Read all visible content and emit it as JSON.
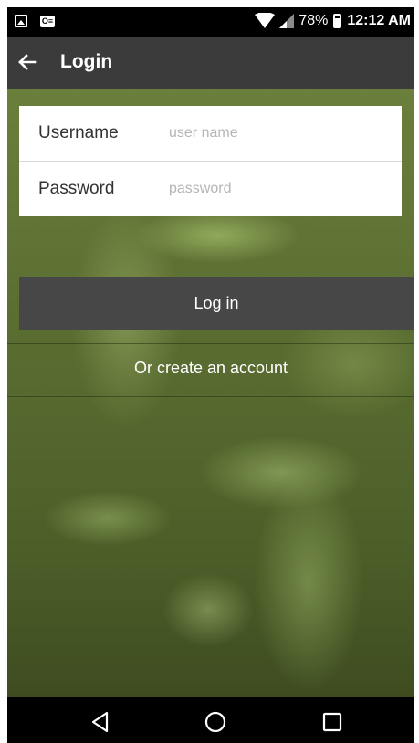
{
  "status_bar": {
    "left_icons": [
      "image-icon",
      "outlook-icon"
    ],
    "outlook_glyph": "O≡",
    "battery": "78%",
    "time": "12:12 AM"
  },
  "app_bar": {
    "title": "Login",
    "back_icon": "arrow-left-icon"
  },
  "form": {
    "username_label": "Username",
    "username_placeholder": "user name",
    "username_value": "",
    "password_label": "Password",
    "password_placeholder": "password",
    "password_value": ""
  },
  "actions": {
    "login_label": "Log in",
    "create_account_label": "Or create an account"
  },
  "nav_bar": {
    "icons": [
      "nav-back-icon",
      "nav-home-icon",
      "nav-recents-icon"
    ]
  },
  "colors": {
    "status_bar": "#000000",
    "app_bar": "#3b3b3b",
    "login_button": "#474747",
    "background": "#5a6d31"
  }
}
